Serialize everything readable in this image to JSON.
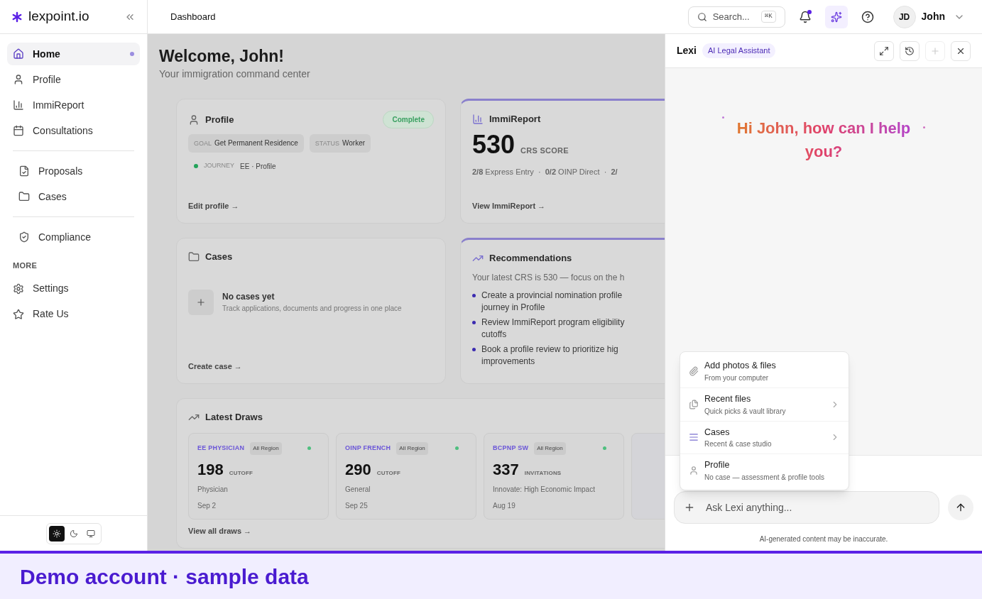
{
  "brand": {
    "name": "lexpoint.io"
  },
  "sidebar": {
    "sections": [
      {
        "items": [
          {
            "label": "Home",
            "selected": true
          },
          {
            "label": "Profile",
            "selected": false
          },
          {
            "label": "ImmiReport",
            "selected": false
          },
          {
            "label": "Consultations",
            "selected": false
          }
        ]
      },
      {
        "items": [
          {
            "label": "Proposals",
            "selected": false
          },
          {
            "label": "Cases",
            "selected": false
          }
        ]
      },
      {
        "items": [
          {
            "label": "Compliance",
            "selected": false
          }
        ]
      },
      {
        "heading": "MORE",
        "items": [
          {
            "label": "Settings",
            "selected": false
          },
          {
            "label": "Rate Us",
            "selected": false
          }
        ]
      }
    ],
    "theme_modes": [
      {
        "selected": true
      },
      {
        "selected": false
      },
      {
        "selected": false
      }
    ]
  },
  "header": {
    "title": "Dashboard",
    "search": {
      "label": "Search...",
      "shortcut": "⌘K"
    },
    "notifications_unread": true,
    "assistant_active": true,
    "user": {
      "initials": "JD",
      "name": "John"
    }
  },
  "dashboard": {
    "title": "Welcome, John!",
    "subtitle": "Your immigration command center",
    "profile_card": {
      "title": "Profile",
      "badge": "Complete",
      "chips": [
        {
          "key": "GOAL",
          "value": "Get Permanent Residence"
        },
        {
          "key": "STATUS",
          "value": "Worker"
        }
      ],
      "journey": {
        "key": "JOURNEY",
        "value": "EE · Profile",
        "color": "#22a35a"
      },
      "link": "Edit profile →"
    },
    "immireport_card": {
      "title": "ImmiReport",
      "score": "530",
      "score_label": "CRS SCORE",
      "stats": "**2/8** Express Entry  ·  **0/2** OINP Direct  ·  **2/**",
      "link": "View ImmiReport →"
    },
    "cases_card": {
      "title": "Cases",
      "empty_title": "No cases yet",
      "empty_text": "Track applications, documents and progress in one place",
      "link": "Create case →"
    },
    "recommendations_card": {
      "title": "Recommendations",
      "intro": "Your latest CRS is 530 — focus on the h",
      "items": [
        {
          "lines": [
            "Create a provincial nomination profile",
            "journey in Profile"
          ]
        },
        {
          "lines": [
            "Review ImmiReport program eligibility",
            "cutoffs"
          ]
        },
        {
          "lines": [
            "Book a profile review to prioritize hig",
            "improvements"
          ]
        }
      ]
    },
    "draws_card": {
      "title": "Latest Draws",
      "draws": [
        {
          "program": "EE PHYSICIAN",
          "region": "All Region",
          "color": "#4fbf7f",
          "value": "198",
          "unit": "CUTOFF",
          "description": "Physician",
          "date": "Sep 2"
        },
        {
          "program": "OINP FRENCH",
          "region": "All Region",
          "color": "#4fbf7f",
          "value": "290",
          "unit": "CUTOFF",
          "description": "General",
          "date": "Sep 25"
        },
        {
          "program": "BCPNP SW",
          "region": "All Region",
          "color": "#4fbf7f",
          "value": "337",
          "unit": "INVITATIONS",
          "description": "Innovate: High Economic Impact",
          "date": "Aug 19"
        }
      ],
      "link": "View all draws →"
    }
  },
  "assistant": {
    "name": "Lexi",
    "badge": "AI Legal Assistant",
    "new_chat_disabled": true,
    "greeting": "Hi John, how can I help you?",
    "attach_menu": [
      {
        "title": "Add photos & files",
        "subtitle": "From your computer",
        "has_submenu": false
      },
      {
        "title": "Recent files",
        "subtitle": "Quick picks & vault library",
        "has_submenu": true
      },
      {
        "title": "Cases",
        "subtitle": "Recent & case studio",
        "has_submenu": true
      },
      {
        "title": "Profile",
        "subtitle": "No case — assessment & profile tools",
        "has_submenu": false
      }
    ],
    "input": {
      "placeholder": "Ask Lexi anything..."
    },
    "disclaimer": "AI-generated content may be inaccurate."
  },
  "banner": {
    "text": "Demo account · sample data"
  }
}
